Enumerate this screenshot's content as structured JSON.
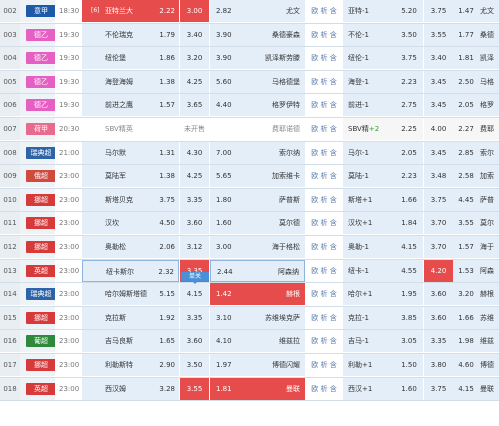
{
  "rows": [
    {
      "num": "002",
      "league": "意甲",
      "lc": "#1e5aa8",
      "time": "18:30",
      "rank": "[6]",
      "home": "亚特兰大",
      "ho": "2.22",
      "draw": "3.00",
      "ao": "2.82",
      "away": "尤文",
      "ops": "欧 析 含",
      "hc": "亚特-1",
      "hcp": "",
      "h1": "5.20",
      "h2": "3.75",
      "h3": "1.47",
      "h4": "尤文",
      "hlHome": true,
      "hlDraw": true
    },
    {
      "num": "003",
      "league": "德乙",
      "lc": "#e65fc2",
      "time": "19:30",
      "rank": "",
      "home": "不伦瑞克",
      "ho": "1.79",
      "draw": "3.40",
      "ao": "3.90",
      "away": "桑德豪森",
      "ops": "欧 析 含",
      "hc": "不伦-1",
      "hcp": "",
      "h1": "3.50",
      "h2": "3.55",
      "h3": "1.77",
      "h4": "桑德"
    },
    {
      "num": "004",
      "league": "德乙",
      "lc": "#e65fc2",
      "time": "19:30",
      "rank": "",
      "home": "纽伦堡",
      "ho": "1.86",
      "draw": "3.20",
      "ao": "3.90",
      "away": "凯泽斯劳滕",
      "ops": "欧 析 含",
      "hc": "纽伦-1",
      "hcp": "",
      "h1": "3.75",
      "h2": "3.40",
      "h3": "1.81",
      "h4": "凯泽"
    },
    {
      "num": "005",
      "league": "德乙",
      "lc": "#e65fc2",
      "time": "19:30",
      "rank": "",
      "home": "海登海姆",
      "ho": "1.38",
      "draw": "4.25",
      "ao": "5.60",
      "away": "马格德堡",
      "ops": "欧 析 含",
      "hc": "海登-1",
      "hcp": "",
      "h1": "2.23",
      "h2": "3.45",
      "h3": "2.50",
      "h4": "马格"
    },
    {
      "num": "006",
      "league": "德乙",
      "lc": "#e65fc2",
      "time": "19:30",
      "rank": "",
      "home": "前进之鹰",
      "ho": "1.57",
      "draw": "3.65",
      "ao": "4.40",
      "away": "格罗伊特",
      "ops": "欧 析 含",
      "hc": "前进-1",
      "hcp": "",
      "h1": "2.75",
      "h2": "3.45",
      "h3": "2.05",
      "h4": "格罗"
    },
    {
      "num": "007",
      "league": "荷甲",
      "lc": "#e96a8c",
      "time": "20:30",
      "rank": "",
      "home": "SBV精英",
      "ho": "",
      "draw": "未开售",
      "ao": "",
      "away": "费耶诺德",
      "ops": "欧 析 含",
      "hc": "SBV精",
      "hcp": "+2",
      "h1": "2.25",
      "h2": "4.00",
      "h3": "2.27",
      "h4": "费耶",
      "pre": true
    },
    {
      "num": "008",
      "league": "瑞典超",
      "lc": "#2e63a8",
      "time": "21:00",
      "rank": "",
      "home": "马尔默",
      "ho": "1.31",
      "draw": "4.30",
      "ao": "7.00",
      "away": "索尔纳",
      "ops": "欧 析 含",
      "hc": "马尔-1",
      "hcp": "",
      "h1": "2.05",
      "h2": "3.45",
      "h3": "2.85",
      "h4": "索尔"
    },
    {
      "num": "009",
      "league": "俄超",
      "lc": "#cf4b3e",
      "time": "23:00",
      "rank": "",
      "home": "莫陆军",
      "ho": "1.38",
      "draw": "4.25",
      "ao": "5.65",
      "away": "加索维卡",
      "ops": "欧 析 含",
      "hc": "莫陆-1",
      "hcp": "",
      "h1": "2.23",
      "h2": "3.48",
      "h3": "2.58",
      "h4": "加索"
    },
    {
      "num": "010",
      "league": "挪超",
      "lc": "#d63a3a",
      "time": "23:00",
      "rank": "",
      "home": "斯塔贝克",
      "ho": "3.75",
      "draw": "3.35",
      "ao": "1.80",
      "away": "萨普斯",
      "ops": "欧 析 含",
      "hc": "斯塔+1",
      "hcp": "",
      "h1": "1.66",
      "h2": "3.75",
      "h3": "4.45",
      "h4": "萨普"
    },
    {
      "num": "011",
      "league": "挪超",
      "lc": "#d63a3a",
      "time": "23:00",
      "rank": "",
      "home": "汉坎",
      "ho": "4.50",
      "draw": "3.60",
      "ao": "1.60",
      "away": "莫尔德",
      "ops": "欧 析 含",
      "hc": "汉坎+1",
      "hcp": "",
      "h1": "1.84",
      "h2": "3.70",
      "h3": "3.55",
      "h4": "莫尔"
    },
    {
      "num": "012",
      "league": "挪超",
      "lc": "#d63a3a",
      "time": "23:00",
      "rank": "",
      "home": "奥勒松",
      "ho": "2.06",
      "draw": "3.12",
      "ao": "3.00",
      "away": "海于格松",
      "ops": "欧 析 含",
      "hc": "奥勒-1",
      "hcp": "",
      "h1": "4.15",
      "h2": "3.70",
      "h3": "1.57",
      "h4": "海于"
    },
    {
      "num": "013",
      "league": "英超",
      "lc": "#d63a3a",
      "time": "23:00",
      "rank": "",
      "home": "纽卡斯尔",
      "ho": "2.32",
      "draw": "3.35",
      "ao": "2.44",
      "away": "阿森纳",
      "ops": "欧 析 含",
      "hc": "纽卡-1",
      "hcp": "",
      "h1": "4.55",
      "h2": "4.20",
      "h3": "1.53",
      "h4": "阿森",
      "hlDraw": true,
      "hlH2": true,
      "sel": true
    },
    {
      "num": "014",
      "league": "瑞典超",
      "lc": "#2e63a8",
      "time": "23:00",
      "rank": "",
      "home": "哈尔姆斯塔德",
      "ho": "5.15",
      "draw": "4.15",
      "ao": "1.42",
      "away": "赫根",
      "ops": "欧 析 含",
      "hc": "哈尔+1",
      "hcp": "",
      "h1": "1.95",
      "h2": "3.60",
      "h3": "3.20",
      "h4": "赫根",
      "hlAway": true
    },
    {
      "num": "015",
      "league": "挪超",
      "lc": "#d63a3a",
      "time": "23:00",
      "rank": "",
      "home": "克拉斯",
      "ho": "1.92",
      "draw": "3.35",
      "ao": "3.10",
      "away": "苏维埃克萨",
      "ops": "欧 析 含",
      "hc": "克拉-1",
      "hcp": "",
      "h1": "3.85",
      "h2": "3.60",
      "h3": "1.66",
      "h4": "苏维"
    },
    {
      "num": "016",
      "league": "葡超",
      "lc": "#2f8a3c",
      "time": "23:00",
      "rank": "",
      "home": "吉马良斯",
      "ho": "1.65",
      "draw": "3.60",
      "ao": "4.10",
      "away": "维兹拉",
      "ops": "欧 析 含",
      "hc": "吉马-1",
      "hcp": "",
      "h1": "3.05",
      "h2": "3.35",
      "h3": "1.98",
      "h4": "维兹"
    },
    {
      "num": "017",
      "league": "挪超",
      "lc": "#d63a3a",
      "time": "23:00",
      "rank": "",
      "home": "利勒斯特",
      "ho": "2.90",
      "draw": "3.50",
      "ao": "1.97",
      "away": "博德闪耀",
      "ops": "欧 析 含",
      "hc": "利勒+1",
      "hcp": "",
      "h1": "1.50",
      "h2": "3.80",
      "h3": "4.60",
      "h4": "博德"
    },
    {
      "num": "018",
      "league": "英超",
      "lc": "#d63a3a",
      "time": "23:00",
      "rank": "",
      "home": "西汉姆",
      "ho": "3.28",
      "draw": "3.55",
      "ao": "1.81",
      "away": "曼联",
      "ops": "欧 析 含",
      "hc": "西汉+1",
      "hcp": "",
      "h1": "1.60",
      "h2": "3.75",
      "h3": "4.15",
      "h4": "曼联",
      "hlDraw": true,
      "hlAway": true
    }
  ],
  "tooltip": "单关"
}
